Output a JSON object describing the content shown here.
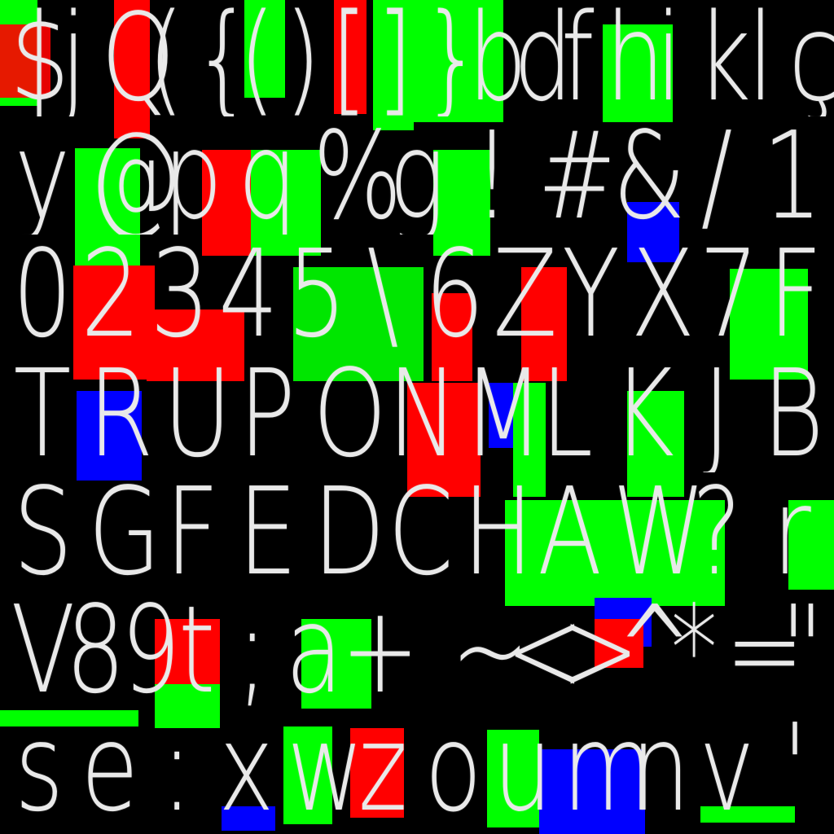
{
  "atlas": {
    "rows": [
      {
        "glyphs": [
          "$",
          "j",
          "Q",
          "(",
          "{",
          "(",
          ")",
          "[",
          "]",
          "}",
          "b",
          "d",
          "f",
          "h",
          "i",
          "k",
          "l",
          "ç"
        ]
      },
      {
        "glyphs": [
          "y",
          "@",
          "p",
          "q",
          "%",
          "g",
          "!",
          "#",
          "&",
          "/",
          "1"
        ]
      },
      {
        "glyphs": [
          "0",
          "2",
          "3",
          "4",
          "5",
          "\\",
          "6",
          "Z",
          "Y",
          "X",
          "7",
          "F"
        ]
      },
      {
        "glyphs": [
          "T",
          "R",
          "U",
          "P",
          "O",
          "N",
          "M",
          "L",
          "K",
          "J",
          "B"
        ]
      },
      {
        "glyphs": [
          "S",
          "G",
          "F",
          "E",
          "D",
          "C",
          "H",
          "A",
          "W",
          "?",
          "r"
        ]
      },
      {
        "glyphs": [
          "V",
          "8",
          "9",
          "t",
          ";",
          "a",
          "+",
          "_",
          "~",
          "<",
          ">",
          "^",
          "*",
          "=",
          "\""
        ]
      },
      {
        "glyphs": [
          "s",
          "e",
          ":",
          "x",
          "w",
          "z",
          "o",
          "u",
          "m",
          "n",
          "v",
          "'"
        ]
      }
    ],
    "colors": {
      "glyph": "#e9e9e9",
      "green": "#00ff00",
      "red": "#ff0000",
      "blue": "#0000ff",
      "magenta": "#c000ff",
      "cyan": "#00d8e0",
      "yellow": "#e8e000",
      "background": "#000000"
    }
  }
}
